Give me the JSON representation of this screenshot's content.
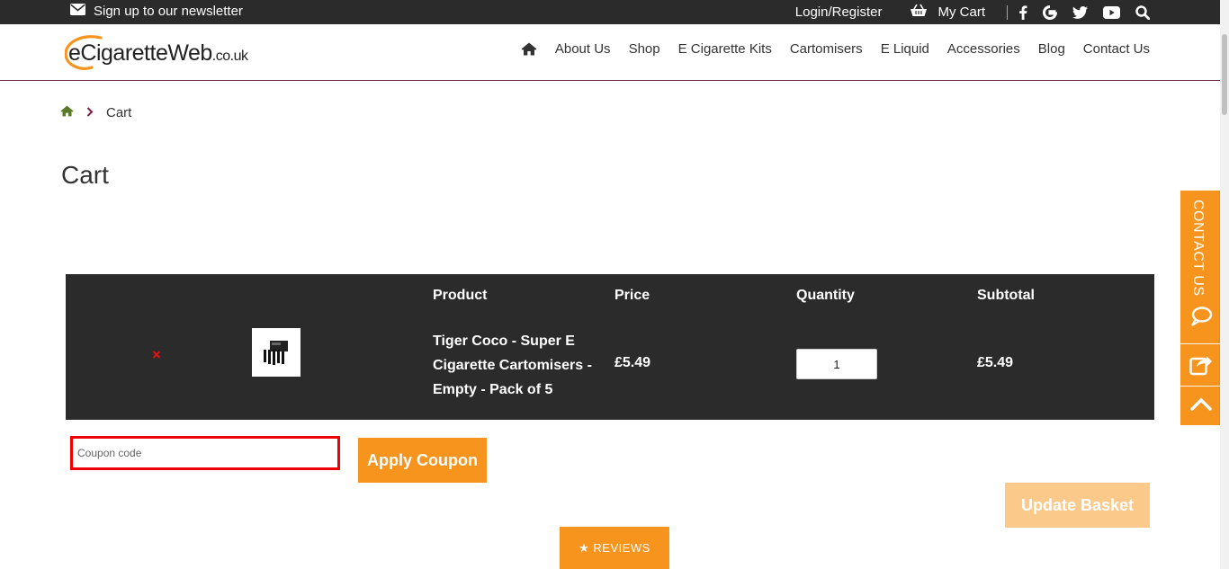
{
  "topbar": {
    "newsletter_label": "Sign up to our newsletter",
    "login_label": "Login/Register",
    "cart_label": "My Cart",
    "social_icons": [
      "facebook-icon",
      "google-icon",
      "twitter-icon",
      "youtube-icon",
      "search-icon"
    ]
  },
  "header": {
    "logo_main": "eCigaretteWeb",
    "logo_tld": ".co.uk",
    "nav": [
      "About Us",
      "Shop",
      "E Cigarette Kits",
      "Cartomisers",
      "E Liquid",
      "Accessories",
      "Blog",
      "Contact Us"
    ]
  },
  "breadcrumb": {
    "current": "Cart"
  },
  "page": {
    "title": "Cart"
  },
  "cart": {
    "headers": {
      "product": "Product",
      "price": "Price",
      "quantity": "Quantity",
      "subtotal": "Subtotal"
    },
    "items": [
      {
        "remove_symbol": "×",
        "name": "Tiger Coco - Super E Cigarette Cartomisers - Empty - Pack of 5",
        "price": "£5.49",
        "quantity": "1",
        "subtotal": "£5.49"
      }
    ]
  },
  "coupon": {
    "placeholder": "Coupon code",
    "apply_label": "Apply Coupon"
  },
  "update_label": "Update Basket",
  "reviews_label": "★ REVIEWS",
  "sidetab": {
    "label": "CONTACT US"
  },
  "colors": {
    "accent": "#f7941d",
    "dark": "#2b2b2b",
    "highlight": "#e00000"
  }
}
